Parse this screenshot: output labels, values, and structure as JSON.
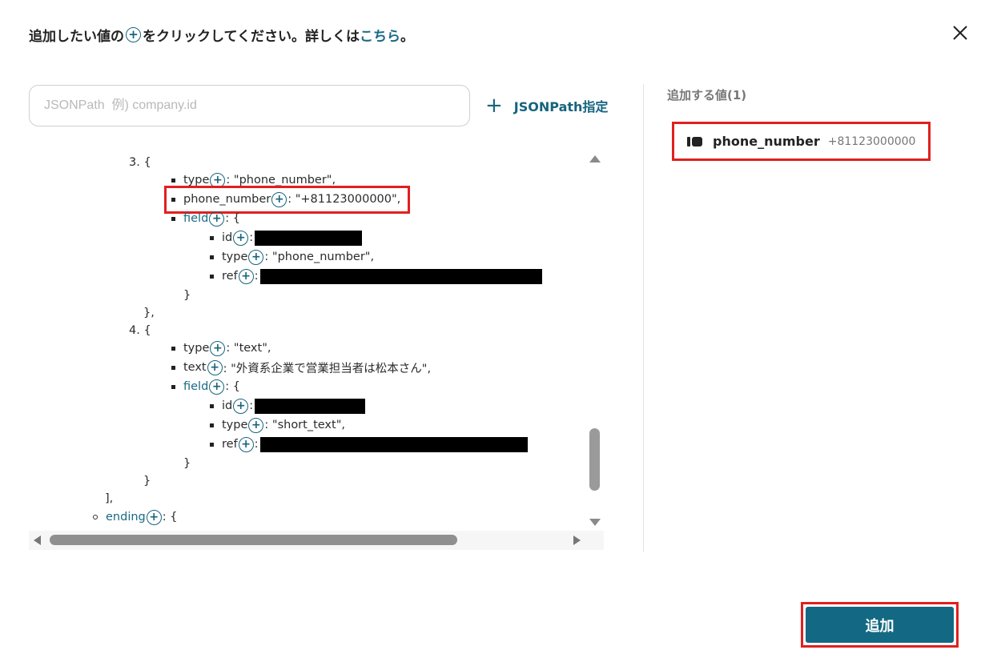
{
  "header": {
    "text_before": "追加したい値の",
    "plus_glyph": "+",
    "text_middle": "をクリックしてください。詳しくは",
    "link_text": "こちら",
    "text_end": "。"
  },
  "close_icon": "close-icon",
  "search": {
    "placeholder": "JSONPath  例) company.id",
    "value": ""
  },
  "jsonpath_button": {
    "icon": "plus",
    "label": "JSONPath指定"
  },
  "tree": {
    "lines": [
      {
        "kind": "text",
        "text": "3. {"
      },
      {
        "kind": "prop",
        "key": "type",
        "value": ": \"phone_number\","
      },
      {
        "kind": "prop",
        "key": "phone_number",
        "value": ": \"+81123000000\",",
        "highlighted": true
      },
      {
        "kind": "prop",
        "key": "field",
        "key_style": "teal",
        "value": ": {"
      },
      {
        "kind": "prop",
        "key": "id",
        "value": ":",
        "redacted": true
      },
      {
        "kind": "prop",
        "key": "type",
        "value": ": \"phone_number\","
      },
      {
        "kind": "prop",
        "key": "ref",
        "value": ":",
        "redacted": true
      },
      {
        "kind": "text",
        "text": "}"
      },
      {
        "kind": "text",
        "text": "},"
      },
      {
        "kind": "text",
        "text": "4. {"
      },
      {
        "kind": "prop",
        "key": "type",
        "value": ": \"text\","
      },
      {
        "kind": "prop",
        "key": "text",
        "value": ": \"外資系企業で営業担当者は松本さん\","
      },
      {
        "kind": "prop",
        "key": "field",
        "key_style": "teal",
        "value": ": {"
      },
      {
        "kind": "prop",
        "key": "id",
        "value": ":",
        "redacted": true
      },
      {
        "kind": "prop",
        "key": "type",
        "value": ": \"short_text\","
      },
      {
        "kind": "prop",
        "key": "ref",
        "value": ":",
        "redacted": true
      },
      {
        "kind": "text",
        "text": "}"
      },
      {
        "kind": "text",
        "text": "}"
      },
      {
        "kind": "text",
        "text": "],"
      },
      {
        "kind": "prop",
        "key": "ending",
        "key_style": "teal",
        "value": ": {"
      }
    ]
  },
  "right_panel": {
    "title": "追加する値(1)",
    "items": [
      {
        "icon": "variable-icon",
        "name": "phone_number",
        "value": "+81123000000"
      }
    ]
  },
  "add_button": {
    "label": "追加"
  },
  "colors": {
    "accent": "#136983",
    "highlight": "#e0201f",
    "link": "#1a6a86"
  }
}
